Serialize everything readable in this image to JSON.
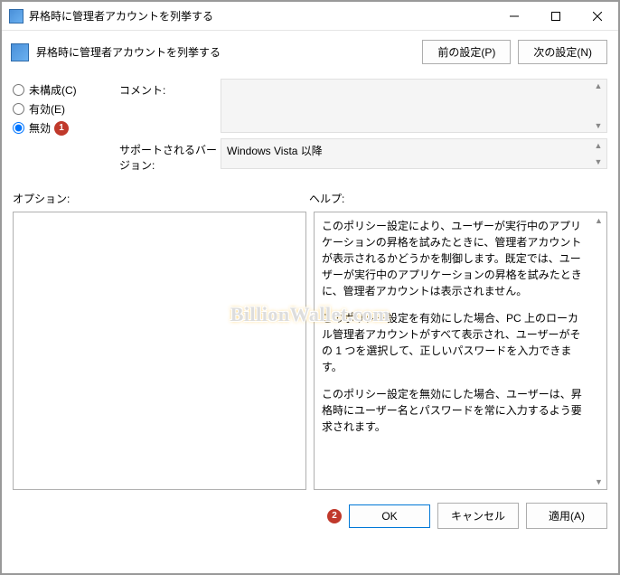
{
  "window": {
    "title": "昇格時に管理者アカウントを列挙する"
  },
  "header": {
    "title": "昇格時に管理者アカウントを列挙する",
    "prev_button": "前の設定(P)",
    "next_button": "次の設定(N)"
  },
  "radios": {
    "not_configured": "未構成(C)",
    "enabled": "有効(E)",
    "disabled": "無効"
  },
  "badges": {
    "one": "1",
    "two": "2"
  },
  "meta": {
    "comment_label": "コメント:",
    "comment_value": "",
    "supported_label": "サポートされるバージョン:",
    "supported_value": "Windows Vista 以降"
  },
  "sections": {
    "options": "オプション:",
    "help": "ヘルプ:"
  },
  "help": {
    "p1": "このポリシー設定により、ユーザーが実行中のアプリケーションの昇格を試みたときに、管理者アカウントが表示されるかどうかを制御します。既定では、ユーザーが実行中のアプリケーションの昇格を試みたときに、管理者アカウントは表示されません。",
    "p2": "このポリシー設定を有効にした場合、PC 上のローカル管理者アカウントがすべて表示され、ユーザーがその 1 つを選択して、正しいパスワードを入力できます。",
    "p3": "このポリシー設定を無効にした場合、ユーザーは、昇格時にユーザー名とパスワードを常に入力するよう要求されます。"
  },
  "footer": {
    "ok": "OK",
    "cancel": "キャンセル",
    "apply": "適用(A)"
  },
  "watermark": "BillionWallet.com"
}
